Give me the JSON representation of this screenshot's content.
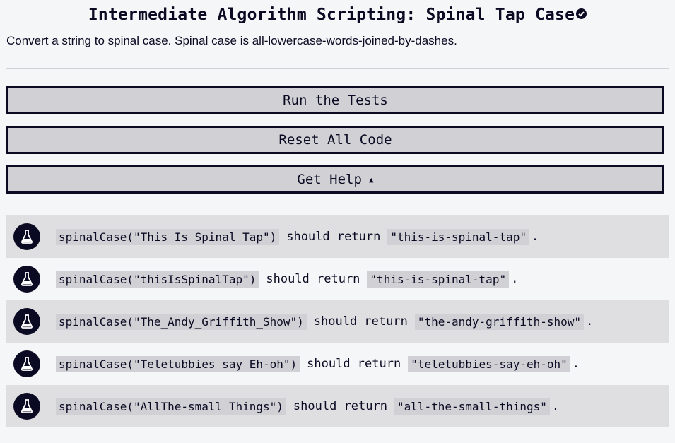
{
  "header": {
    "title": "Intermediate Algorithm Scripting: Spinal Tap Case",
    "description": "Convert a string to spinal case. Spinal case is all-lowercase-words-joined-by-dashes."
  },
  "buttons": {
    "run": "Run the Tests",
    "reset": "Reset All Code",
    "help": "Get Help",
    "help_caret": "▲"
  },
  "tests": [
    {
      "call": "spinalCase(\"This Is Spinal Tap\")",
      "text": "should return",
      "expected": "\"this-is-spinal-tap\"",
      "end": "."
    },
    {
      "call": "spinalCase(\"thisIsSpinalTap\")",
      "text": "should return",
      "expected": "\"this-is-spinal-tap\"",
      "end": "."
    },
    {
      "call": "spinalCase(\"The_Andy_Griffith_Show\")",
      "text": "should return",
      "expected": "\"the-andy-griffith-show\"",
      "end": "."
    },
    {
      "call": "spinalCase(\"Teletubbies say Eh-oh\")",
      "text": "should return",
      "expected": "\"teletubbies-say-eh-oh\"",
      "end": "."
    },
    {
      "call": "spinalCase(\"AllThe-small Things\")",
      "text": "should return",
      "expected": "\"all-the-small-things\"",
      "end": "."
    }
  ],
  "colors": {
    "dark": "#0a0a23",
    "button_bg": "#d0d0d5",
    "row_shade": "#dfdfe2",
    "page_bg": "#f5f6f7"
  },
  "icons": {
    "completed": "check-circle-icon",
    "test": "flask-icon"
  }
}
